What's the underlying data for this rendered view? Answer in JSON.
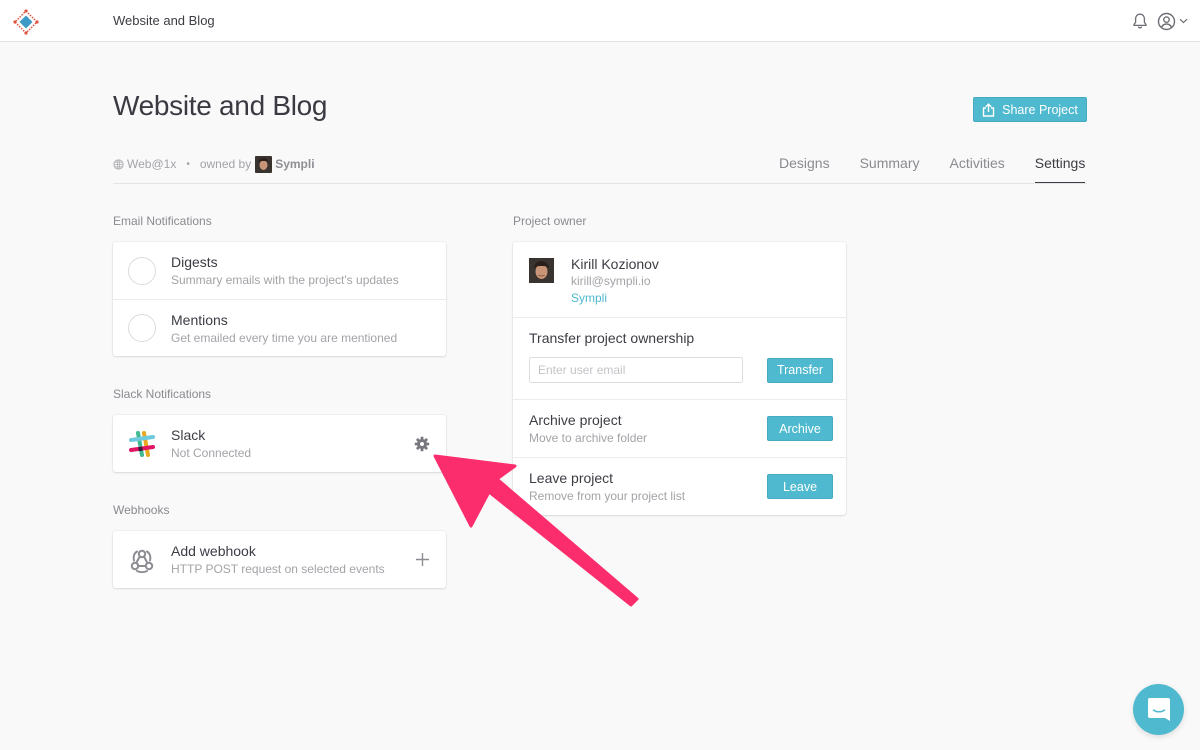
{
  "topbar": {
    "title": "Website and Blog",
    "icons": [
      "logo-icon",
      "bell-icon",
      "user-circle-icon",
      "chevron-down-icon"
    ]
  },
  "header": {
    "title": "Website and Blog",
    "share_label": "Share Project",
    "platform": "Web@1x",
    "separator": "•",
    "owned_by_label": "owned by",
    "owner_team": "Sympli"
  },
  "tabs": [
    {
      "label": "Designs",
      "active": false
    },
    {
      "label": "Summary",
      "active": false
    },
    {
      "label": "Activities",
      "active": false
    },
    {
      "label": "Settings",
      "active": true
    }
  ],
  "email_notifications": {
    "label": "Email Notifications",
    "items": [
      {
        "title": "Digests",
        "subtitle": "Summary emails with the project's updates",
        "checked": false
      },
      {
        "title": "Mentions",
        "subtitle": "Get emailed every time you are mentioned",
        "checked": false
      }
    ]
  },
  "slack_notifications": {
    "label": "Slack Notifications",
    "title": "Slack",
    "status": "Not Connected"
  },
  "webhooks": {
    "label": "Webhooks",
    "title": "Add webhook",
    "subtitle": "HTTP POST request on selected events"
  },
  "project_owner": {
    "label": "Project owner",
    "name": "Kirill Kozionov",
    "email": "kirill@sympli.io",
    "team": "Sympli",
    "transfer": {
      "title": "Transfer project ownership",
      "placeholder": "Enter user email",
      "value": "",
      "button": "Transfer"
    },
    "archive": {
      "title": "Archive project",
      "subtitle": "Move to archive folder",
      "button": "Archive"
    },
    "leave": {
      "title": "Leave project",
      "subtitle": "Remove from your project list",
      "button": "Leave"
    }
  },
  "colors": {
    "accent": "#4fb9cf",
    "annotation_arrow": "#fb2d6c",
    "background": "#f9f9f9"
  }
}
